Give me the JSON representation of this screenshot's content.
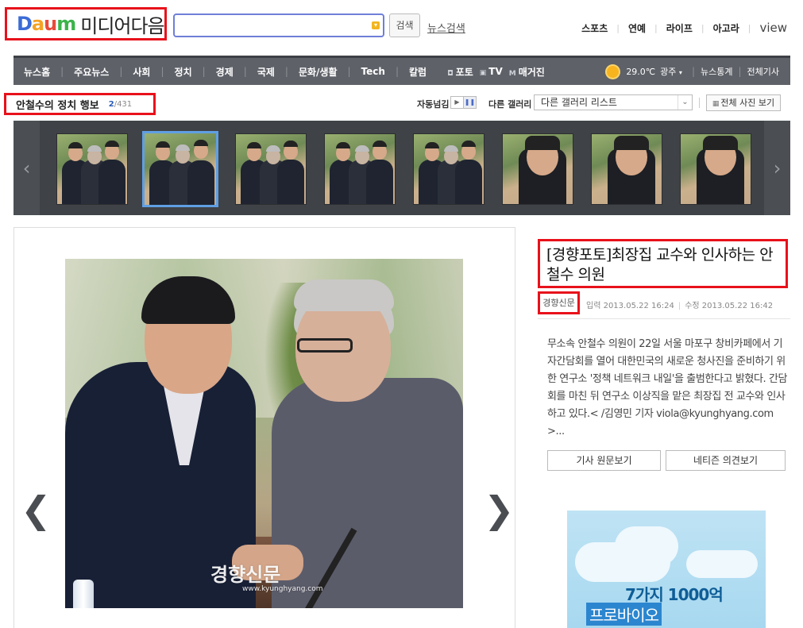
{
  "header": {
    "logo_brand": "DAUM",
    "logo_text": "미디어다음",
    "search_value": "",
    "search_button": "검색",
    "news_search": "뉴스검색",
    "top_links": [
      "스포츠",
      "연예",
      "라이프",
      "아고라"
    ],
    "view_link": "view"
  },
  "nav": {
    "items": [
      "뉴스홈",
      "주요뉴스",
      "사회",
      "정치",
      "경제",
      "국제",
      "문화/생활",
      "Tech",
      "칼럼"
    ],
    "photo": "포토",
    "tv": "TV",
    "magazine": "매거진",
    "weather_temp": "29.0℃",
    "weather_city": "광주",
    "news_stats": "뉴스통계",
    "all_articles": "전체기사"
  },
  "gallery": {
    "title": "안철수의 정치 행보",
    "current": "2",
    "total": "/431",
    "auto_label": "자동넘김",
    "other_label": "다른 갤러리",
    "select_value": "다른 갤러리 리스트",
    "all_photos": "전체 사진 보기",
    "selected_index": 1
  },
  "photo": {
    "watermark": "경향신문",
    "watermark_sub": "www.kyunghyang.com"
  },
  "article": {
    "title": "[경향포토]최장집 교수와 인사하는 안철수 의원",
    "source": "경향신문",
    "input_time": "입력 2013.05.22 16:24",
    "edit_time": "수정 2013.05.22 16:42",
    "summary": "무소속 안철수 의원이 22일 서울 마포구 창비카페에서 기자간담회를 열어 대한민국의 새로운 청사진을 준비하기 위한 연구소 '정책 네트워크 내일'을 출범한다고 밝혔다. 간담회를 마친 뒤 연구소 이상직을 맡은 최장집 전 교수와 인사하고 있다.< /김영민 기자 viola@kyunghyang.com >...",
    "button_original": "기사 원문보기",
    "button_comments": "네티즌 의견보기"
  },
  "ad": {
    "line1": "7가지 1000억",
    "line2": "프로바이오"
  },
  "colors": {
    "highlight_red": "#e8111b",
    "nav_bg": "#5e6168",
    "strip_bg": "#3f4246",
    "selected_thumb": "#5f9fe4"
  }
}
